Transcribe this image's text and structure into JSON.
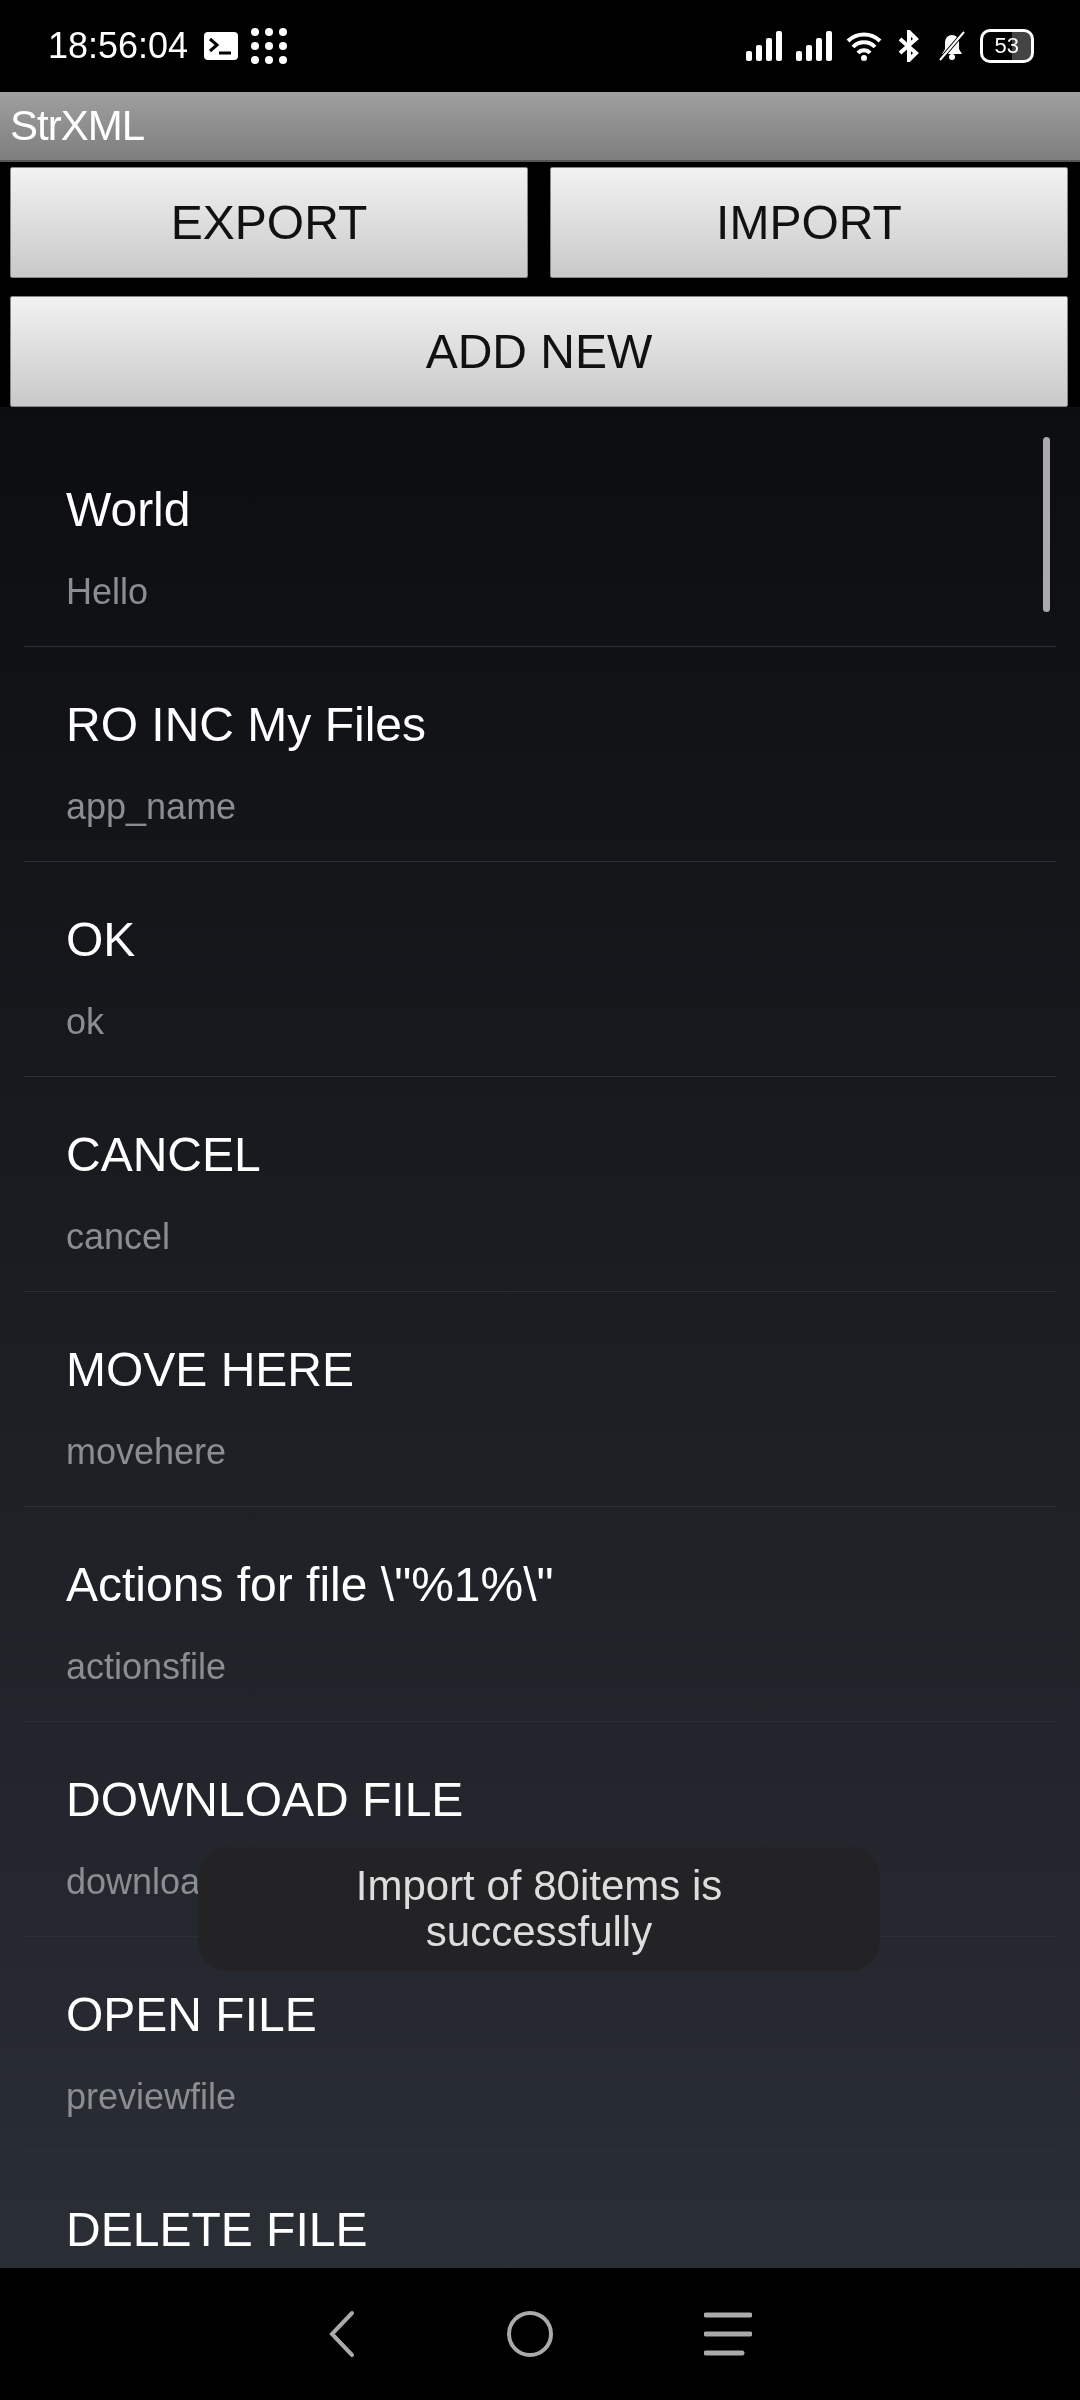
{
  "status_bar": {
    "time": "18:56:04",
    "battery": "53"
  },
  "app_bar": {
    "title": "StrXML"
  },
  "buttons": [
    {
      "label": "EXPORT"
    },
    {
      "label": "IMPORT"
    }
  ],
  "add_button": {
    "label": "ADD NEW"
  },
  "items": [
    {
      "title": "World",
      "key": "Hello"
    },
    {
      "title": "RO INC My Files",
      "key": "app_name"
    },
    {
      "title": "OK",
      "key": "ok"
    },
    {
      "title": "CANCEL",
      "key": "cancel"
    },
    {
      "title": "MOVE HERE",
      "key": "movehere"
    },
    {
      "title": "Actions for file \\\"%1%\\\"",
      "key": "actionsfile"
    },
    {
      "title": "DOWNLOAD FILE",
      "key": "downloa"
    },
    {
      "title": "OPEN FILE",
      "key": "previewfile"
    },
    {
      "title": "DELETE FILE"
    }
  ],
  "toast": {
    "text": "Import of 80items is successfully"
  }
}
